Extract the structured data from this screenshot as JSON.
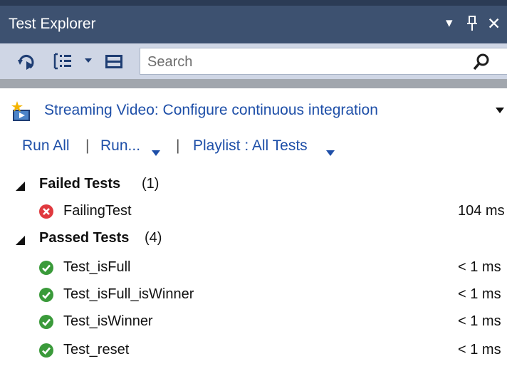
{
  "window": {
    "title": "Test Explorer",
    "menu_caret_glyph": "▾",
    "pin_glyph": "ᛎ",
    "close_glyph": "✕"
  },
  "toolbar": {
    "search_placeholder": "Search",
    "icons": [
      "run-stopped-icon",
      "group-by-icon",
      "playlist-icon",
      "search-icon"
    ]
  },
  "banner": {
    "text": "Streaming Video: Configure continuous integration",
    "icon": "streaming-video-icon"
  },
  "actions": {
    "run_all": "Run All",
    "separator": "|",
    "run": "Run...",
    "playlist": "Playlist : All Tests"
  },
  "groups": [
    {
      "name": "Failed Tests",
      "count": "(1)",
      "tests": [
        {
          "name": "FailingTest",
          "time": "104 ms",
          "status": "failed"
        }
      ]
    },
    {
      "name": "Passed Tests",
      "count": "(4)",
      "tests": [
        {
          "name": "Test_isFull",
          "time": "< 1 ms",
          "status": "passed"
        },
        {
          "name": "Test_isFull_isWinner",
          "time": "< 1 ms",
          "status": "passed"
        },
        {
          "name": "Test_isWinner",
          "time": "< 1 ms",
          "status": "passed"
        },
        {
          "name": "Test_reset",
          "time": "< 1 ms",
          "status": "passed"
        }
      ]
    }
  ],
  "colors": {
    "title_bar": "#3d5170",
    "toolbar": "#cfd6e5",
    "link": "#1e4fa8",
    "failed": "#e0393e",
    "passed": "#3a9a3a"
  }
}
